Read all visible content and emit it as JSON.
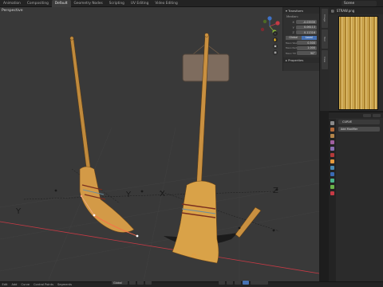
{
  "topbar": {
    "tabs": [
      "Animation",
      "Compositing",
      "Default",
      "Geometry Nodes",
      "Scripting",
      "UV Editing",
      "Video Editing"
    ],
    "active_tab": "Default",
    "scene": "Scene"
  },
  "viewport": {
    "title": "Perspective",
    "axes": {
      "x": "X",
      "y": "Y",
      "z": "Z"
    }
  },
  "npanel": {
    "header": "Transform",
    "subheader": "Median:",
    "rows": [
      {
        "label": "X",
        "value": "-0.03939"
      },
      {
        "label": "Y",
        "value": "0.06113"
      },
      {
        "label": "Z",
        "value": "0.11316"
      }
    ],
    "toggle": {
      "left": "Global",
      "right": "Local"
    },
    "rows2": [
      {
        "label": "Mean Weight",
        "value": "0.500"
      },
      {
        "label": "Mean Radius",
        "value": "1.000"
      },
      {
        "label": "Mean Tilt",
        "value": "90°"
      }
    ],
    "properties_label": "Properties"
  },
  "image_editor": {
    "image_name": "STRAW.png",
    "vtabs": [
      "Image",
      "Tool",
      "View"
    ]
  },
  "properties": {
    "object_name": "CURVE",
    "add_modifier": "Add Modifier"
  },
  "bottombar": {
    "menus": [
      "Edit",
      "Add",
      "Curve",
      "Control Points",
      "Segments"
    ],
    "orientation": "Global"
  },
  "colors": {
    "accent": "#4772b3",
    "curve_select": "#ff6a4a",
    "axis_x": "#c63a45",
    "axis_y": "#86b33a",
    "axis_z": "#3f72c6"
  }
}
